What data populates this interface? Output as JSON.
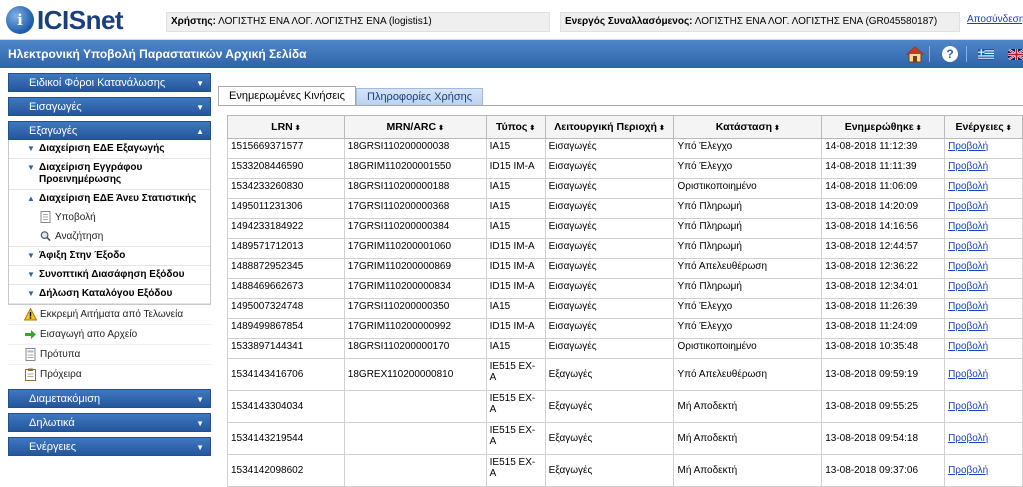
{
  "app": {
    "logo_text": "ICISnet",
    "logo_badge": "i"
  },
  "topbar": {
    "user_label": "Χρήστης:",
    "user_value": "ΛΟΓΙΣΤΗΣ ΕΝΑ ΛΟΓ. ΛΟΓΙΣΤΗΣ ΕΝΑ (logistis1)",
    "party_label": "Ενεργός Συναλλασόμενος:",
    "party_value": "ΛΟΓΙΣΤΗΣ ΕΝΑ ΛΟΓ. ΛΟΓΙΣΤΗΣ ΕΝΑ (GR045580187)",
    "logout": "Αποσύνδεση"
  },
  "header": {
    "title": "Ηλεκτρονική Υποβολή Παραστατικών Αρχική Σελίδα",
    "help": "?"
  },
  "sidebar": {
    "sections": [
      {
        "label": "Ειδικοί Φόροι Κατανάλωσης"
      },
      {
        "label": "Εισαγωγές"
      },
      {
        "label": "Εξαγωγές"
      },
      {
        "label": "Διαμετακόμιση"
      },
      {
        "label": "Δηλωτικά"
      },
      {
        "label": "Ενέργειες"
      }
    ],
    "exports": {
      "sub1": "Διαχείριση ΕΔΕ Εξαγωγής",
      "sub2": "Διαχείριση Εγγράφου Προεινημέρωσης",
      "sub3": "Διαχείριση ΕΔΕ Άνευ Στατιστικής",
      "leaf1": "Υποβολή",
      "leaf2": "Αναζήτηση",
      "sub4": "Άφιξη Στην Έξοδο",
      "sub5": "Συνοπτική Διασάφηση Εξόδου",
      "sub6": "Δήλωση Καταλόγου Εξόδου"
    },
    "items": [
      {
        "label": "Εκκρεμή Αιτήματα από Τελωνεία"
      },
      {
        "label": "Εισαγωγή απο Αρχείο"
      },
      {
        "label": "Πρότυπα"
      },
      {
        "label": "Πρόχειρα"
      }
    ]
  },
  "tabs": [
    {
      "label": "Ενημερωμένες Κινήσεις"
    },
    {
      "label": "Πληροφορίες Χρήσης"
    }
  ],
  "table": {
    "columns": [
      "LRN",
      "MRN/ARC",
      "Τύπος",
      "Λειτουργική Περιοχή",
      "Κατάσταση",
      "Ενημερώθηκε",
      "Ενέργειες"
    ],
    "sort_glyph": "⬍",
    "rows": [
      {
        "lrn": "1515669371577",
        "mrn": "18GRSI110200000038",
        "type": "IA15",
        "area": "Εισαγωγές",
        "status": "Υπό Έλεγχο",
        "updated": "14-08-2018 11:12:39",
        "action": "Προβολή"
      },
      {
        "lrn": "1533208446590",
        "mrn": "18GRIM110200001550",
        "type": "ID15 IM-A",
        "area": "Εισαγωγές",
        "status": "Υπό Έλεγχο",
        "updated": "14-08-2018 11:11:39",
        "action": "Προβολή"
      },
      {
        "lrn": "1534233260830",
        "mrn": "18GRSI110200000188",
        "type": "IA15",
        "area": "Εισαγωγές",
        "status": "Οριστικοποιημένο",
        "updated": "14-08-2018 11:06:09",
        "action": "Προβολή"
      },
      {
        "lrn": "1495011231306",
        "mrn": "17GRSI110200000368",
        "type": "IA15",
        "area": "Εισαγωγές",
        "status": "Υπό Πληρωμή",
        "updated": "13-08-2018 14:20:09",
        "action": "Προβολή"
      },
      {
        "lrn": "1494233184922",
        "mrn": "17GRSI110200000384",
        "type": "IA15",
        "area": "Εισαγωγές",
        "status": "Υπό Πληρωμή",
        "updated": "13-08-2018 14:16:56",
        "action": "Προβολή"
      },
      {
        "lrn": "1489571712013",
        "mrn": "17GRIM110200001060",
        "type": "ID15 IM-A",
        "area": "Εισαγωγές",
        "status": "Υπό Πληρωμή",
        "updated": "13-08-2018 12:44:57",
        "action": "Προβολή"
      },
      {
        "lrn": "1488872952345",
        "mrn": "17GRIM110200000869",
        "type": "ID15 IM-A",
        "area": "Εισαγωγές",
        "status": "Υπό Απελευθέρωση",
        "updated": "13-08-2018 12:36:22",
        "action": "Προβολή"
      },
      {
        "lrn": "1488469662673",
        "mrn": "17GRIM110200000834",
        "type": "ID15 IM-A",
        "area": "Εισαγωγές",
        "status": "Υπό Πληρωμή",
        "updated": "13-08-2018 12:34:01",
        "action": "Προβολή"
      },
      {
        "lrn": "1495007324748",
        "mrn": "17GRSI110200000350",
        "type": "IA15",
        "area": "Εισαγωγές",
        "status": "Υπό Έλεγχο",
        "updated": "13-08-2018 11:26:39",
        "action": "Προβολή"
      },
      {
        "lrn": "1489499867854",
        "mrn": "17GRIM110200000992",
        "type": "ID15 IM-A",
        "area": "Εισαγωγές",
        "status": "Υπό Έλεγχο",
        "updated": "13-08-2018 11:24:09",
        "action": "Προβολή"
      },
      {
        "lrn": "1533897144341",
        "mrn": "18GRSI110200000170",
        "type": "IA15",
        "area": "Εισαγωγές",
        "status": "Οριστικοποιημένο",
        "updated": "13-08-2018 10:35:48",
        "action": "Προβολή"
      },
      {
        "lrn": "1534143416706",
        "mrn": "18GREX110200000810",
        "type": "IE515 EX-A",
        "area": "Εξαγωγές",
        "status": "Υπό Απελευθέρωση",
        "updated": "13-08-2018 09:59:19",
        "action": "Προβολή"
      },
      {
        "lrn": "1534143304034",
        "mrn": "",
        "type": "IE515 EX-A",
        "area": "Εξαγωγές",
        "status": "Μή Αποδεκτή",
        "updated": "13-08-2018 09:55:25",
        "action": "Προβολή"
      },
      {
        "lrn": "1534143219544",
        "mrn": "",
        "type": "IE515 EX-A",
        "area": "Εξαγωγές",
        "status": "Μή Αποδεκτή",
        "updated": "13-08-2018 09:54:18",
        "action": "Προβολή"
      },
      {
        "lrn": "1534142098602",
        "mrn": "",
        "type": "IE515 EX-A",
        "area": "Εξαγωγές",
        "status": "Μή Αποδεκτή",
        "updated": "13-08-2018 09:37:06",
        "action": "Προβολή"
      }
    ]
  },
  "colors": {
    "header_blue": "#3a6fb5",
    "link": "#1a3fbf",
    "tab_inactive": "#c6daf2"
  }
}
